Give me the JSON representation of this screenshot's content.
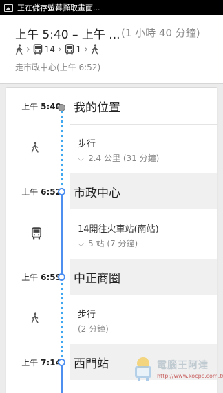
{
  "status_bar": {
    "text": "正在儲存螢幕擷取畫面..."
  },
  "header": {
    "time_range": "上午 5:40 – 上午 ...",
    "duration": "(1 小時 40 分鐘)",
    "route": [
      {
        "type": "walk"
      },
      {
        "type": "bus",
        "number": "14"
      },
      {
        "type": "bus",
        "number": "1"
      },
      {
        "type": "walk"
      }
    ],
    "subtitle": "走市政中心(上午 6:52)"
  },
  "itinerary": {
    "stops": [
      {
        "period": "上午",
        "time": "5:40",
        "name": "我的位置"
      },
      {
        "period": "上午",
        "time": "6:52",
        "name": "市政中心"
      },
      {
        "period": "上午",
        "time": "6:59",
        "name": "中正商圈"
      },
      {
        "period": "上午",
        "time": "7:14",
        "name": "西門站"
      }
    ],
    "segments": [
      {
        "mode": "walk",
        "title": "步行",
        "detail": "2.4 公里 (31 分鐘)"
      },
      {
        "mode": "bus",
        "title": "14開往火車站(南站)",
        "detail": "5 站 (7 分鐘)"
      },
      {
        "mode": "walk",
        "title": "步行",
        "detail": "(2 分鐘)"
      }
    ]
  },
  "watermark": {
    "text": "電腦王阿達",
    "url": "http://www.kocpc.com.tw"
  },
  "colors": {
    "route_line": "#4c8ff0",
    "walk_dots": "#3fa6f0"
  }
}
